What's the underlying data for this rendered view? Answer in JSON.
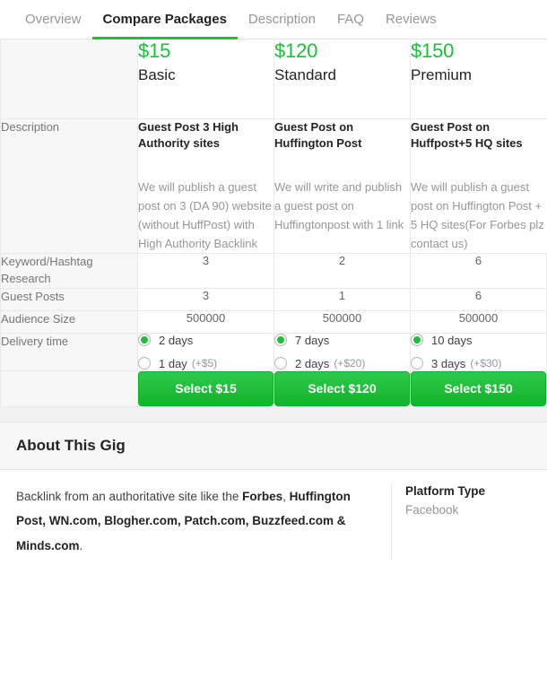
{
  "tabs": [
    {
      "label": "Overview",
      "active": false
    },
    {
      "label": "Compare Packages",
      "active": true
    },
    {
      "label": "Description",
      "active": false
    },
    {
      "label": "FAQ",
      "active": false
    },
    {
      "label": "Reviews",
      "active": false
    }
  ],
  "accent_green": "#1dbf39",
  "packages": [
    {
      "price": "$15",
      "name": "Basic",
      "desc_title": "Guest Post 3 High Authority sites",
      "desc_body": "We will publish a guest post on 3 (DA 90) website (without HuffPost) with High Authority Backlink",
      "keyword_research": "3",
      "guest_posts": "3",
      "audience_size": "500000",
      "delivery": [
        {
          "label": "2 days",
          "extra": "",
          "selected": true
        },
        {
          "label": "1 day",
          "extra": "(+$5)",
          "selected": false
        }
      ],
      "select_label": "Select $15"
    },
    {
      "price": "$120",
      "name": "Standard",
      "desc_title": "Guest Post on Huffington Post",
      "desc_body": "We will write and publish a guest post on Huffingtonpost with 1 link",
      "keyword_research": "2",
      "guest_posts": "1",
      "audience_size": "500000",
      "delivery": [
        {
          "label": "7 days",
          "extra": "",
          "selected": true
        },
        {
          "label": "2 days",
          "extra": "(+$20)",
          "selected": false
        }
      ],
      "select_label": "Select $120"
    },
    {
      "price": "$150",
      "name": "Premium",
      "desc_title": "Guest Post on Huffpost+5 HQ sites",
      "desc_body": "We will publish a guest post on Huffington Post + 5 HQ sites(For Forbes plz contact us)",
      "keyword_research": "6",
      "guest_posts": "6",
      "audience_size": "500000",
      "delivery": [
        {
          "label": "10 days",
          "extra": "",
          "selected": true
        },
        {
          "label": "3 days",
          "extra": "(+$30)",
          "selected": false
        }
      ],
      "select_label": "Select $150"
    }
  ],
  "row_labels": {
    "description": "Description",
    "keyword_research": "Keyword/Hashtag Research",
    "guest_posts": "Guest Posts",
    "audience_size": "Audience Size",
    "delivery_time": "Delivery time"
  },
  "about": {
    "heading": "About This Gig",
    "paragraph_parts": [
      {
        "text": "Backlink from an authoritative site like the ",
        "bold": false
      },
      {
        "text": "Forbes",
        "bold": true
      },
      {
        "text": ", ",
        "bold": false
      },
      {
        "text": "Huffington Post, WN.com, Blogher.com, Patch.com, Buzzfeed.com & Minds.com",
        "bold": true
      },
      {
        "text": ".",
        "bold": false
      }
    ],
    "meta": {
      "label": "Platform Type",
      "value": "Facebook"
    }
  }
}
